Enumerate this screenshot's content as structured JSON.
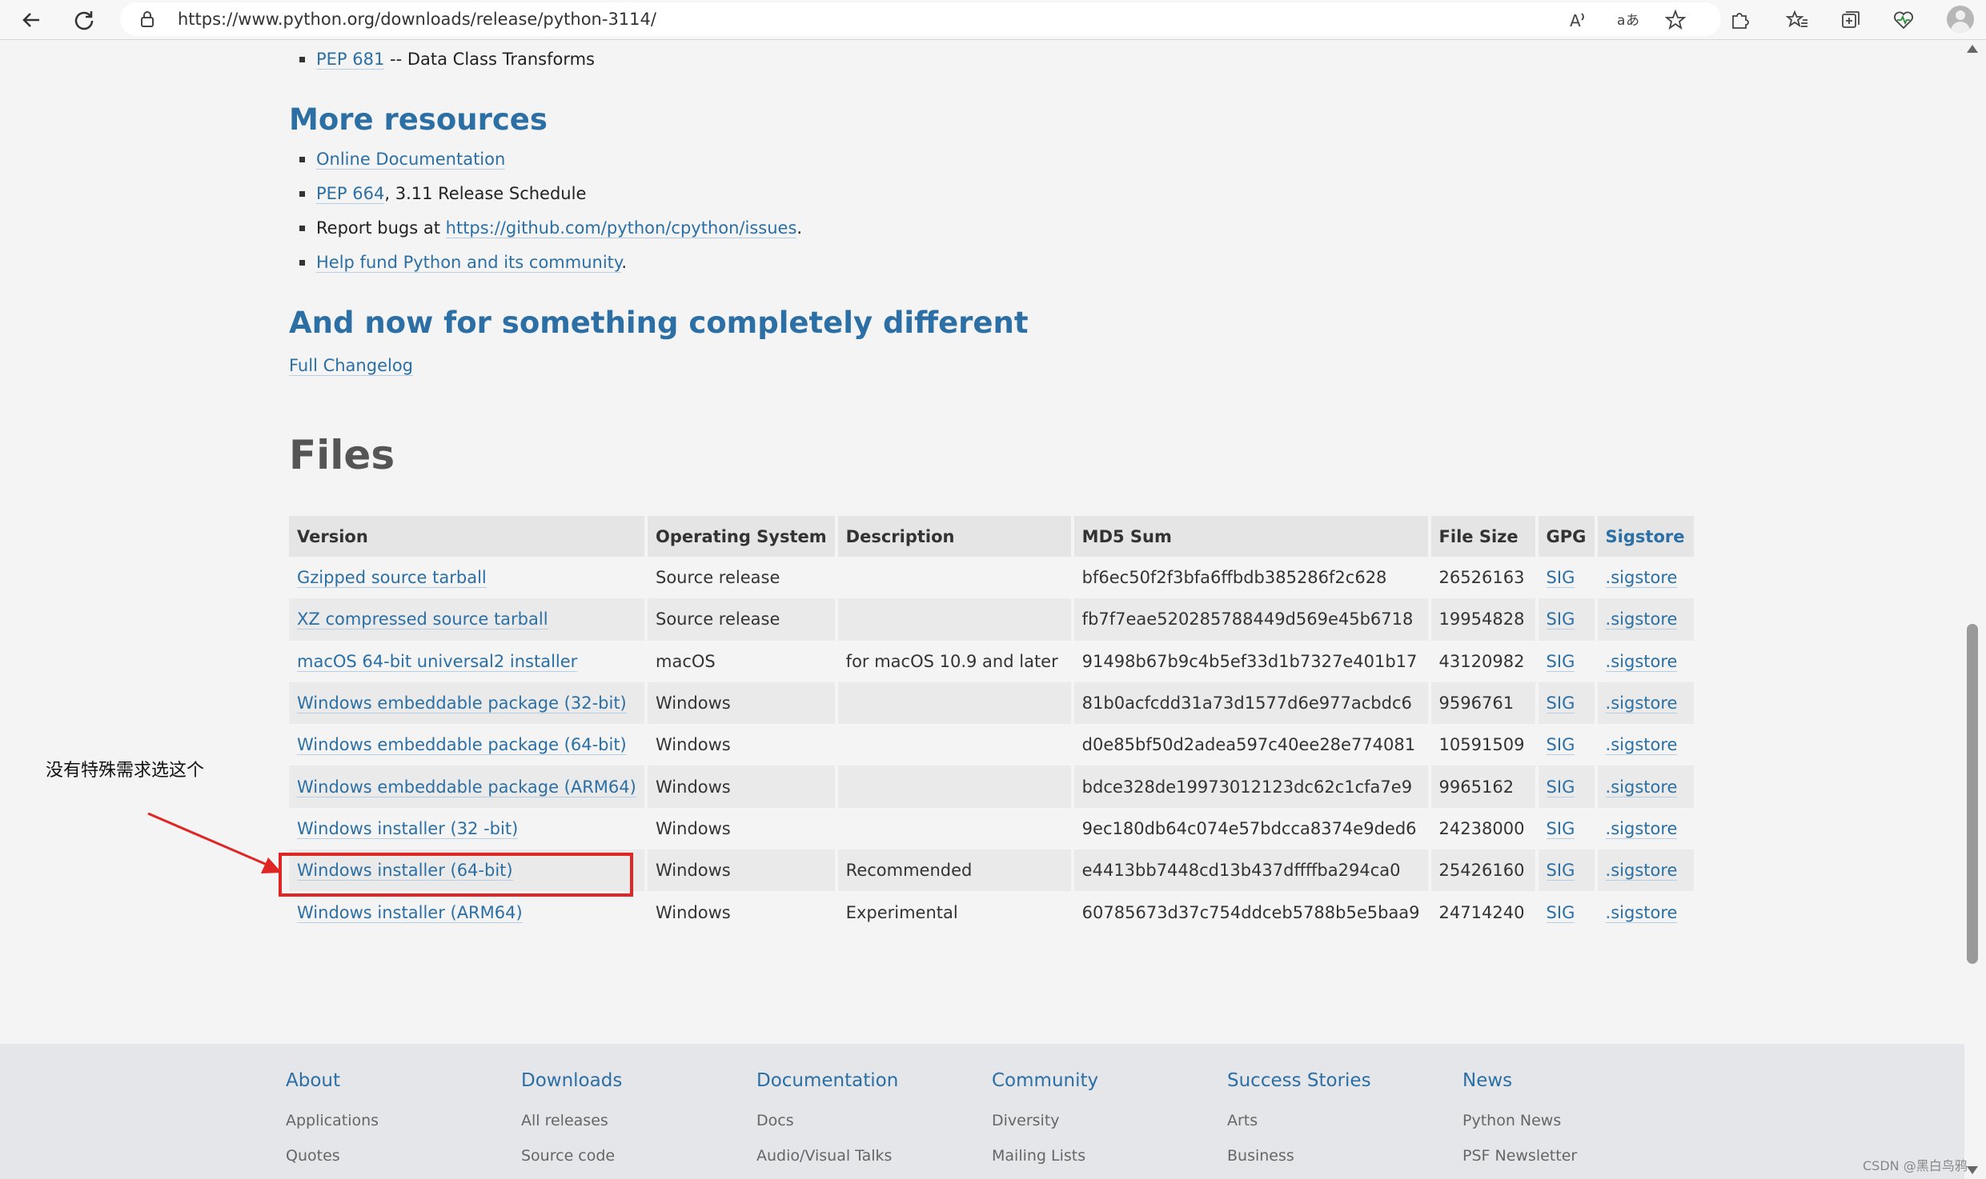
{
  "browser": {
    "url": "https://www.python.org/downloads/release/python-3114/"
  },
  "top_bullets": [
    {
      "link": "PEP 681",
      "text": " -- Data Class Transforms"
    }
  ],
  "more_resources": {
    "heading": "More resources",
    "items": [
      {
        "link": "Online Documentation",
        "pre": "",
        "post": ""
      },
      {
        "link": "PEP 664",
        "pre": "",
        "post": ", 3.11 Release Schedule"
      },
      {
        "link": "https://github.com/python/cpython/issues",
        "pre": "Report bugs at ",
        "post": "."
      },
      {
        "link": "Help fund Python and its community",
        "pre": "",
        "post": "."
      }
    ]
  },
  "different": {
    "heading": "And now for something completely different",
    "changelog": "Full Changelog"
  },
  "files": {
    "heading": "Files",
    "columns": [
      "Version",
      "Operating System",
      "Description",
      "MD5 Sum",
      "File Size",
      "GPG",
      "Sigstore"
    ],
    "rows": [
      {
        "version": "Gzipped source tarball",
        "os": "Source release",
        "desc": "",
        "md5": "bf6ec50f2f3bfa6ffbdb385286f2c628",
        "size": "26526163",
        "gpg": "SIG",
        "sigstore": ".sigstore"
      },
      {
        "version": "XZ compressed source tarball",
        "os": "Source release",
        "desc": "",
        "md5": "fb7f7eae520285788449d569e45b6718",
        "size": "19954828",
        "gpg": "SIG",
        "sigstore": ".sigstore"
      },
      {
        "version": "macOS 64-bit universal2 installer",
        "os": "macOS",
        "desc": "for macOS 10.9 and later",
        "md5": "91498b67b9c4b5ef33d1b7327e401b17",
        "size": "43120982",
        "gpg": "SIG",
        "sigstore": ".sigstore"
      },
      {
        "version": "Windows embeddable package (32-bit)",
        "os": "Windows",
        "desc": "",
        "md5": "81b0acfcdd31a73d1577d6e977acbdc6",
        "size": "9596761",
        "gpg": "SIG",
        "sigstore": ".sigstore"
      },
      {
        "version": "Windows embeddable package (64-bit)",
        "os": "Windows",
        "desc": "",
        "md5": "d0e85bf50d2adea597c40ee28e774081",
        "size": "10591509",
        "gpg": "SIG",
        "sigstore": ".sigstore"
      },
      {
        "version": "Windows embeddable package (ARM64)",
        "os": "Windows",
        "desc": "",
        "md5": "bdce328de19973012123dc62c1cfa7e9",
        "size": "9965162",
        "gpg": "SIG",
        "sigstore": ".sigstore"
      },
      {
        "version": "Windows installer (32 -bit)",
        "os": "Windows",
        "desc": "",
        "md5": "9ec180db64c074e57bdcca8374e9ded6",
        "size": "24238000",
        "gpg": "SIG",
        "sigstore": ".sigstore"
      },
      {
        "version": "Windows installer (64-bit)",
        "os": "Windows",
        "desc": "Recommended",
        "md5": "e4413bb7448cd13b437dffffba294ca0",
        "size": "25426160",
        "gpg": "SIG",
        "sigstore": ".sigstore"
      },
      {
        "version": "Windows installer (ARM64)",
        "os": "Windows",
        "desc": "Experimental",
        "md5": "60785673d37c754ddceb5788b5e5baa9",
        "size": "24714240",
        "gpg": "SIG",
        "sigstore": ".sigstore"
      }
    ]
  },
  "annotation": {
    "note": "没有特殊需求选这个",
    "color": "#e02525"
  },
  "footer": {
    "columns": [
      {
        "heading": "About",
        "items": [
          "Applications",
          "Quotes"
        ]
      },
      {
        "heading": "Downloads",
        "items": [
          "All releases",
          "Source code"
        ]
      },
      {
        "heading": "Documentation",
        "items": [
          "Docs",
          "Audio/Visual Talks"
        ]
      },
      {
        "heading": "Community",
        "items": [
          "Diversity",
          "Mailing Lists"
        ]
      },
      {
        "heading": "Success Stories",
        "items": [
          "Arts",
          "Business"
        ]
      },
      {
        "heading": "News",
        "items": [
          "Python News",
          "PSF Newsletter"
        ]
      }
    ]
  },
  "watermark": "CSDN @黑白鸟鸦",
  "colors": {
    "link": "#2b6fa5",
    "page_bg": "#f4f4f4",
    "footer_bg": "#e4e6e9",
    "highlight": "#e02525"
  },
  "icons": [
    "back-arrow-icon",
    "refresh-icon",
    "lock-icon",
    "read-aloud-icon",
    "translate-icon",
    "favorite-star-icon",
    "extensions-icon",
    "favorites-icon",
    "collections-icon",
    "health-icon",
    "profile-avatar-icon"
  ]
}
